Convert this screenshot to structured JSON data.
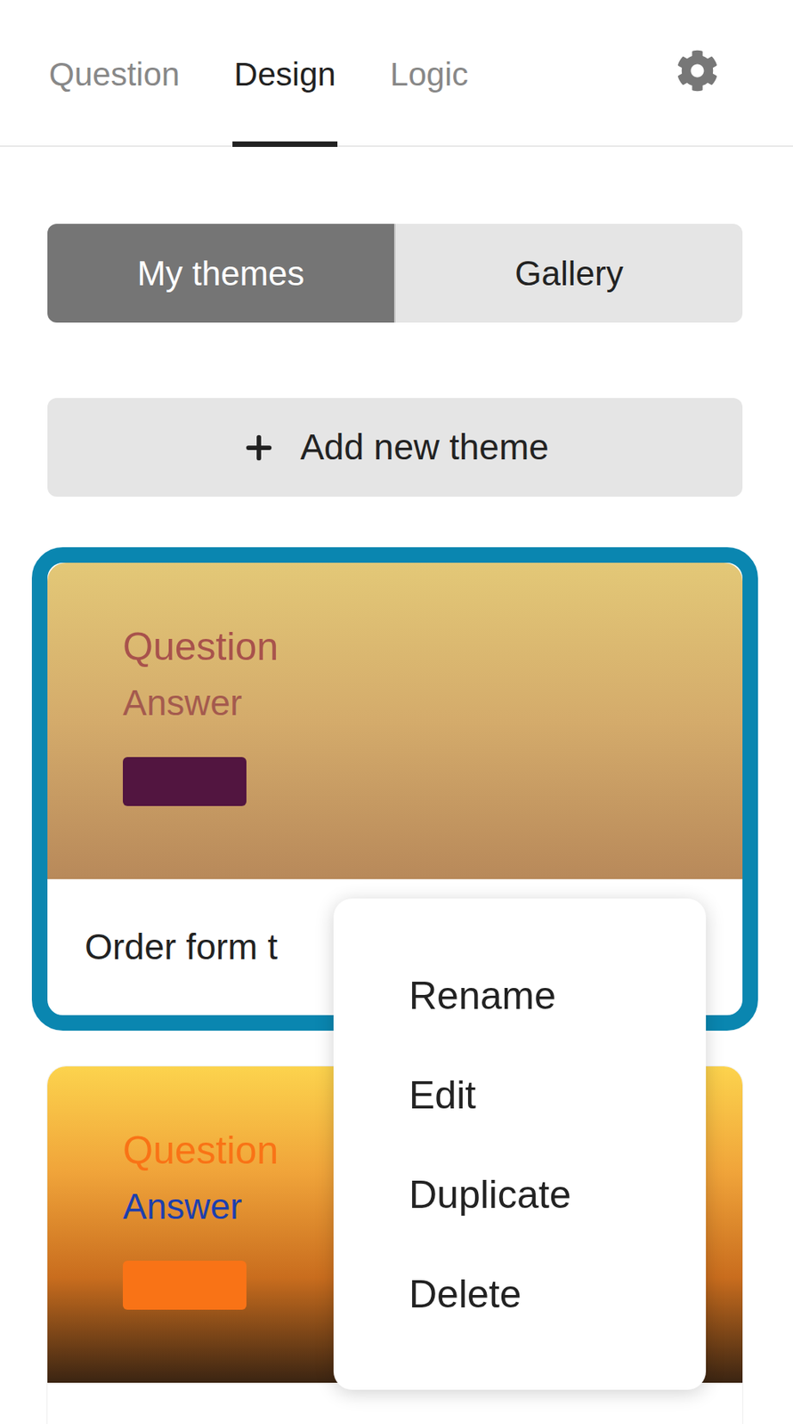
{
  "tabs": [
    {
      "label": "Question",
      "selected": false
    },
    {
      "label": "Design",
      "selected": true
    },
    {
      "label": "Logic",
      "selected": false
    }
  ],
  "theme_source": [
    {
      "label": "My themes",
      "selected": true
    },
    {
      "label": "Gallery",
      "selected": false
    }
  ],
  "add_button": {
    "label": "Add new theme"
  },
  "themes": [
    {
      "name": "Order form t",
      "selected": true,
      "question": "Question",
      "answer": "Answer",
      "question_color": "#a8524c",
      "answer_color": "#a45a4e",
      "button_color": "#521540",
      "background_colors": [
        "#e3c877",
        "#d4ab6b",
        "#b8895a"
      ]
    },
    {
      "name": "",
      "selected": false,
      "question": "Question",
      "answer": "Answer",
      "question_color": "#f97316",
      "answer_color": "#1d3fae",
      "button_color": "#f97316",
      "background_colors": [
        "#fcd34d",
        "#f0a43a",
        "#c96d1e",
        "#3a2412"
      ]
    }
  ],
  "context_menu": {
    "items": [
      "Rename",
      "Edit",
      "Duplicate",
      "Delete"
    ]
  }
}
